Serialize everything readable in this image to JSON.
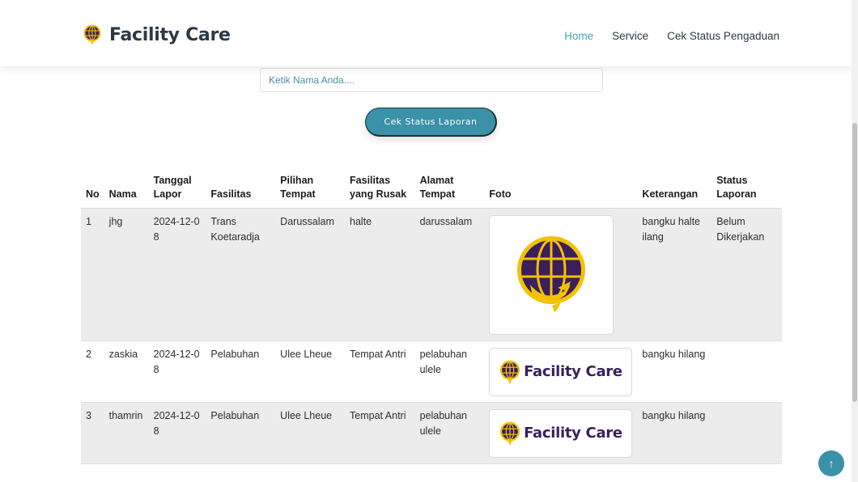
{
  "header": {
    "brand": "Facility Care",
    "nav": [
      "Home",
      "Service",
      "Cek Status Pengaduan"
    ]
  },
  "search": {
    "placeholder": "Ketik Nama Anda....",
    "button_label": "Cek Status Laporan"
  },
  "table": {
    "columns": [
      "No",
      "Nama",
      "Tanggal Lapor",
      "Fasilitas",
      "Pilihan Tempat",
      "Fasilitas yang Rusak",
      "Alamat Tempat",
      "Foto",
      "Keterangan",
      "Status Laporan"
    ],
    "rows": [
      {
        "no": "1",
        "nama": "jhg",
        "tanggal": "2024-12-08",
        "fasilitas": "Trans Koetaradja",
        "tempat": "Darussalam",
        "rusak": "halte",
        "alamat": "darussalam",
        "foto": "emblem-logo",
        "keterangan": "bangku halte ilang",
        "status": "Belum Dikerjakan"
      },
      {
        "no": "2",
        "nama": "zaskia",
        "tanggal": "2024-12-08",
        "fasilitas": "Pelabuhan",
        "tempat": "Ulee Lheue",
        "rusak": "Tempat Antri",
        "alamat": "pelabuhan ulele",
        "foto": "facility-care-logo",
        "foto_text": "Facility Care",
        "keterangan": "bangku hilang",
        "status": ""
      },
      {
        "no": "3",
        "nama": "thamrin",
        "tanggal": "2024-12-08",
        "fasilitas": "Pelabuhan",
        "tempat": "Ulee Lheue",
        "rusak": "Tempat Antri",
        "alamat": "pelabuhan ulele",
        "foto": "facility-care-logo",
        "foto_text": "Facility Care",
        "keterangan": "bangku hilang",
        "status": ""
      }
    ]
  },
  "back_to_top": {
    "icon": "arrow-up-icon",
    "glyph": "↑"
  },
  "colors": {
    "accent": "#3a91a8",
    "nav_active": "#4aa2b3",
    "brand_purple": "#3a1f5c",
    "brand_yellow": "#f2c200"
  }
}
